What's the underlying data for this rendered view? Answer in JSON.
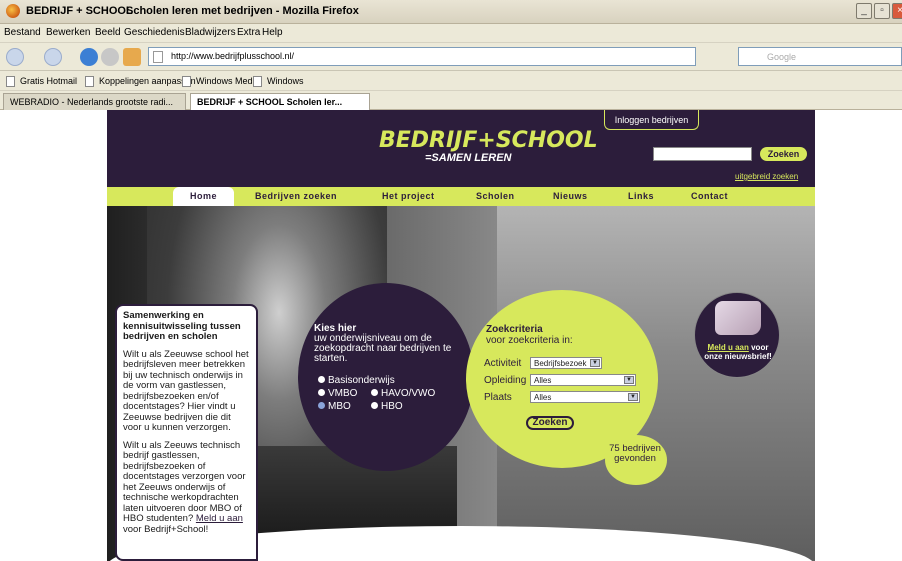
{
  "window": {
    "title_left": "BEDRIJF + SCHOOL",
    "title_right": "Scholen leren met bedrijven - Mozilla Firefox",
    "minimize": "_",
    "maximize": "▫",
    "close": "×"
  },
  "menu": [
    "Bestand",
    "Bewerken",
    "Beeld",
    "Geschiedenis",
    "Bladwijzers",
    "Extra",
    "Help"
  ],
  "address": {
    "url": "http://www.bedrijfplusschool.nl/"
  },
  "search": {
    "placeholder": "Google"
  },
  "bookmarks": [
    "Gratis Hotmail",
    "Koppelingen aanpassen",
    "Windows Media",
    "Windows"
  ],
  "tabs": [
    {
      "label": "WEBRADIO - Nederlands grootste radi...",
      "active": false
    },
    {
      "label": "BEDRIJF + SCHOOL   Scholen ler...",
      "active": true
    }
  ],
  "site": {
    "login": "Inloggen bedrijven",
    "logo_main": "BEDRIJF+SCHOOL",
    "logo_sub": "=SAMEN LEREN",
    "search_button": "Zoeken",
    "advanced_search": "uitgebreid zoeken",
    "nav": [
      "Home",
      "Bedrijven zoeken",
      "Het project",
      "Scholen",
      "Nieuws",
      "Links",
      "Contact"
    ],
    "left_box": {
      "heading": "Samenwerking en kennisuitwisseling tussen bedrijven en scholen",
      "p1": "Wilt u als Zeeuwse school het bedrijfsleven meer betrekken bij uw technisch onderwijs in de vorm van gastlessen, bedrijfsbezoeken en/of docentstages? Hier vindt u Zeeuwse bedrijven die dit voor u kunnen verzorgen.",
      "p2_start": "Wilt u als Zeeuws technisch bedrijf gastlessen, bedrijfsbezoeken of docentstages verzorgen voor het Zeeuws onderwijs of technische werkopdrachten laten uitvoeren door MBO of HBO studenten?",
      "p2_link": "Meld u aan",
      "p2_end": "voor Bedrijf+School!"
    },
    "level": {
      "heading": "Kies hier",
      "desc": "uw onderwijsniveau om de zoekopdracht naar bedrijven te starten.",
      "options": [
        "Basisonderwijs",
        "VMBO",
        "HAVO/VWO",
        "MBO",
        "HBO"
      ],
      "selected": "MBO"
    },
    "criteria": {
      "heading": "Zoekcriteria",
      "desc": "voor zoekcriteria in:",
      "labels": [
        "Activiteit",
        "Opleiding",
        "Plaats"
      ],
      "values": [
        "Bedrijfsbezoek",
        "Alles",
        "Alles"
      ],
      "button": "Zoeken",
      "count": "75 bedrijven gevonden"
    },
    "newsletter": {
      "link": "Meld u aan",
      "text": "voor onze nieuwsbrief!"
    }
  }
}
